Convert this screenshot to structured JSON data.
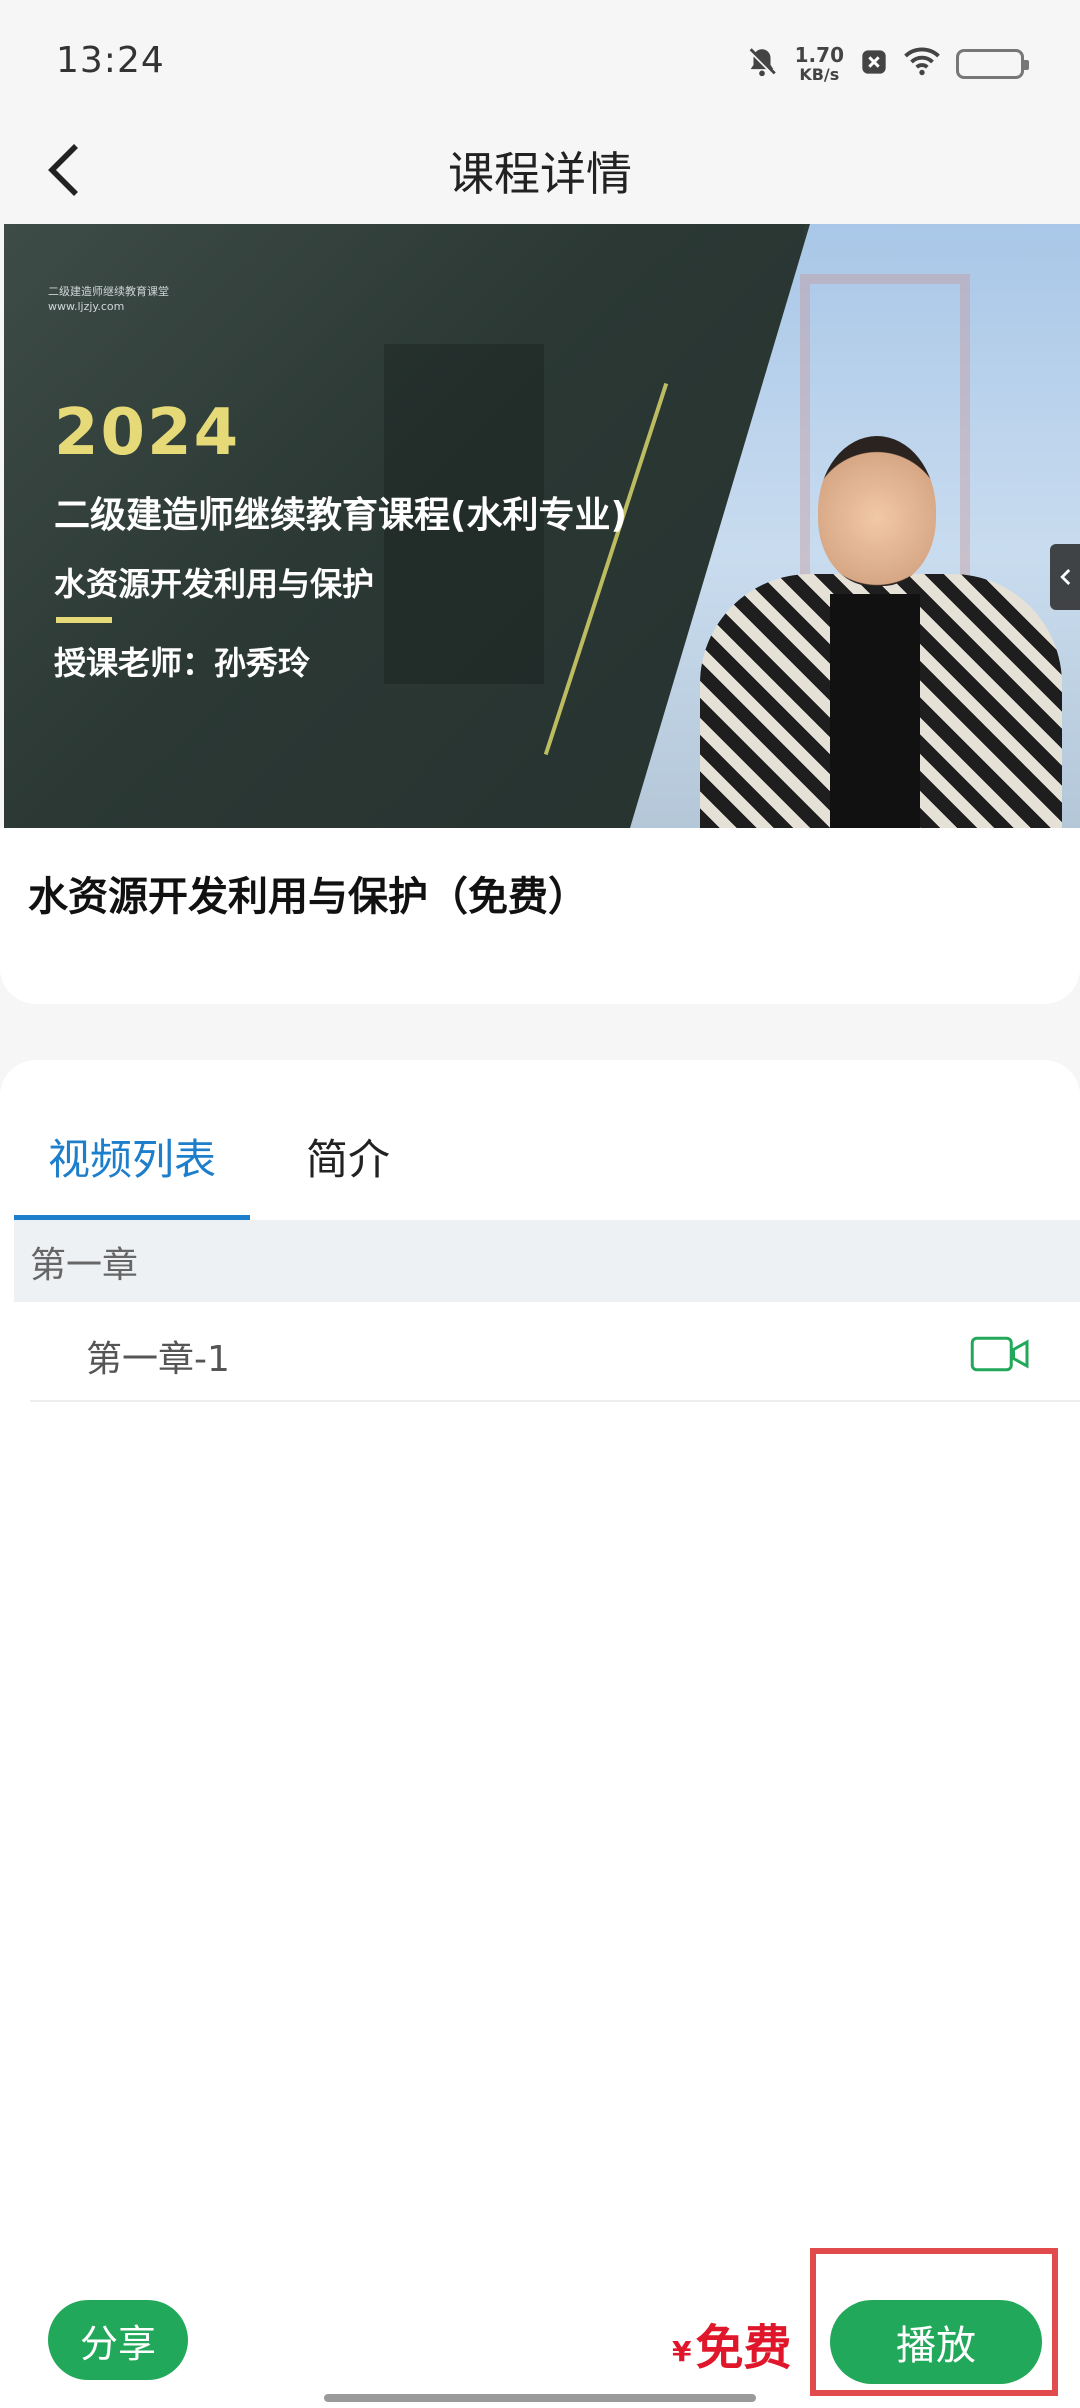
{
  "status_bar": {
    "time": "13:24",
    "net_speed_value": "1.70",
    "net_speed_unit": "KB/s",
    "battery_color": "#8d86e6",
    "icons": [
      "mute-bell-icon",
      "close-box-icon",
      "wifi-icon",
      "battery-icon"
    ]
  },
  "header": {
    "title": "课程详情",
    "back_icon": "chevron-left-icon"
  },
  "video": {
    "watermark_line1": "二级建造师继续教育课堂",
    "watermark_line2": "www.ljzjy.com",
    "year": "2024",
    "line1": "二级建造师继续教育课程(水利专业)",
    "line2": "水资源开发利用与保护",
    "line3": "授课老师：孙秀玲"
  },
  "course": {
    "title": "水资源开发利用与保护（免费）"
  },
  "tabs": {
    "video_list": "视频列表",
    "intro": "简介",
    "active": "视频列表",
    "accent_color": "#1d7fcb"
  },
  "chapters": [
    {
      "title": "第一章",
      "lessons": [
        {
          "title": "第一章-1",
          "icon": "video-camera-icon"
        }
      ]
    }
  ],
  "bottom_bar": {
    "share_label": "分享",
    "price_symbol": "¥",
    "price_value": "免费",
    "play_label": "播放",
    "button_color": "#22a85a",
    "price_color": "#e0162b"
  }
}
